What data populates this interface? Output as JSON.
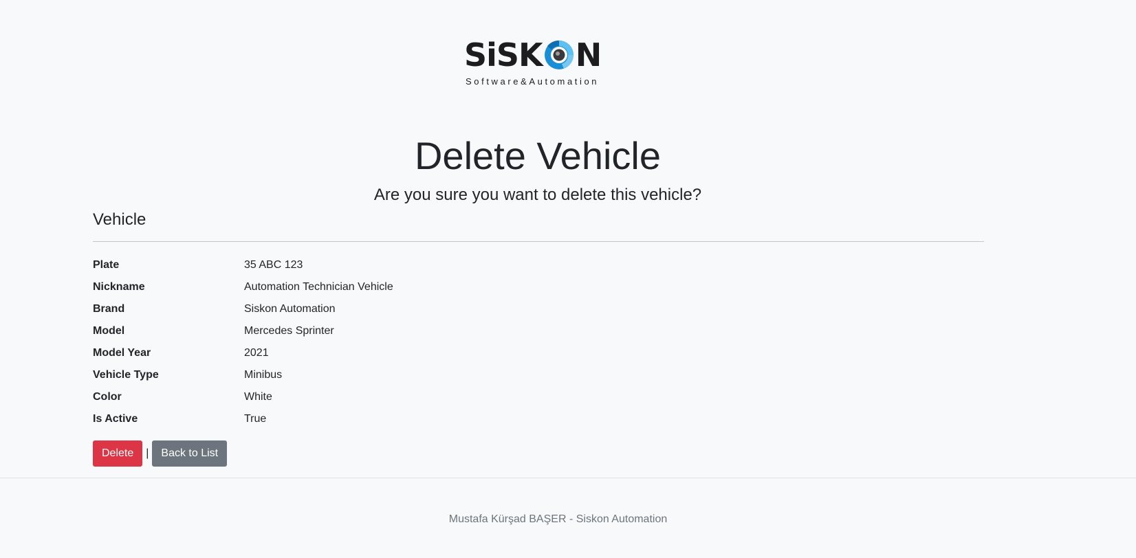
{
  "brand": {
    "logo_text_left": "SiSK",
    "logo_text_right": "N",
    "tagline": "Software&Automation",
    "colors": {
      "primary_blue": "#1a8fd6",
      "dark": "#1d1d1f"
    }
  },
  "page": {
    "title": "Delete Vehicle",
    "confirm_question": "Are you sure you want to delete this vehicle?",
    "section_title": "Vehicle"
  },
  "details": [
    {
      "label": "Plate",
      "value": "35 ABC 123"
    },
    {
      "label": "Nickname",
      "value": "Automation Technician Vehicle"
    },
    {
      "label": "Brand",
      "value": "Siskon Automation"
    },
    {
      "label": "Model",
      "value": "Mercedes Sprinter"
    },
    {
      "label": "Model Year",
      "value": "2021"
    },
    {
      "label": "Vehicle Type",
      "value": "Minibus"
    },
    {
      "label": "Color",
      "value": "White"
    },
    {
      "label": "Is Active",
      "value": "True"
    }
  ],
  "actions": {
    "delete_label": "Delete",
    "separator": "|",
    "back_label": "Back to List",
    "colors": {
      "danger": "#dc3545",
      "secondary": "#6c757d"
    }
  },
  "footer": {
    "text": "Mustafa Kürşad BAŞER - Siskon Automation"
  }
}
